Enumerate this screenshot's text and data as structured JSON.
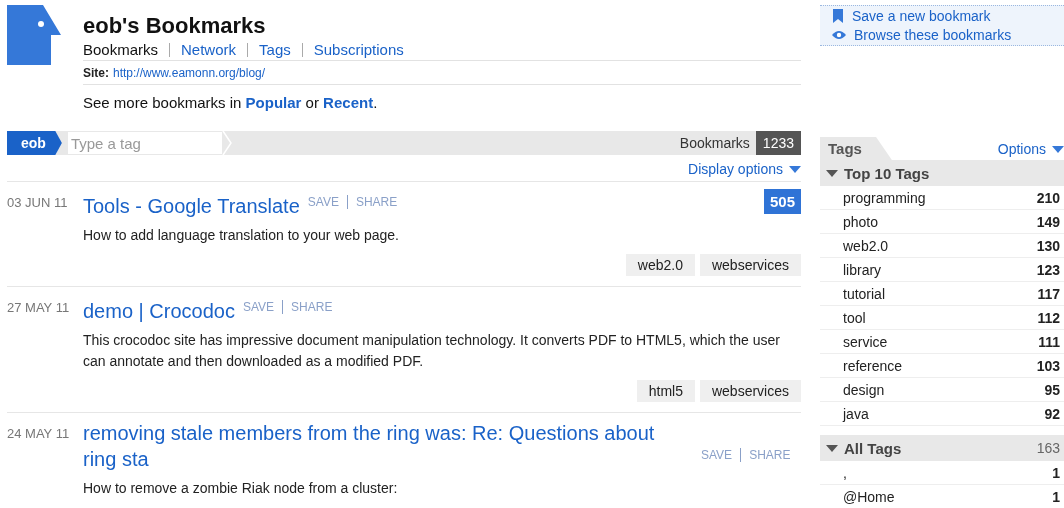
{
  "header": {
    "title": "eob's Bookmarks",
    "nav": [
      {
        "label": "Bookmarks",
        "selected": true
      },
      {
        "label": "Network",
        "selected": false
      },
      {
        "label": "Tags",
        "selected": false
      },
      {
        "label": "Subscriptions",
        "selected": false
      }
    ],
    "site_label": "Site:",
    "site_url": "http://www.eamonn.org/blog/",
    "more": {
      "prefix": "See more bookmarks in",
      "link_1": "Popular",
      "middle": "or",
      "link_2": "Recent",
      "suffix": "."
    }
  },
  "actions": [
    {
      "kind": "save",
      "label": "Save a new bookmark"
    },
    {
      "kind": "browse",
      "label": "Browse these bookmarks"
    }
  ],
  "tag_bar": {
    "user": "eob",
    "placeholder": "Type a tag",
    "count_label": "Bookmarks",
    "count": "1233"
  },
  "display_options": "Display options",
  "bookmarks": [
    {
      "date": "03 JUN 11",
      "title": "Tools - Google Translate",
      "save": "SAVE",
      "share": "SHARE",
      "count": "505",
      "description": "How to add language translation to your web page.",
      "tags": [
        "web2.0",
        "webservices"
      ]
    },
    {
      "date": "27 MAY 11",
      "title": "demo | Crocodoc",
      "save": "SAVE",
      "share": "SHARE",
      "description": "This crocodoc site has impressive document manipulation technology.  It converts PDF to HTML5, which the user can annotate and then downloaded as a modified PDF.",
      "tags": [
        "html5",
        "webservices"
      ]
    },
    {
      "date": "24 MAY 11",
      "title": "removing stale members from the ring was: Re: Questions about ring sta",
      "save": "SAVE",
      "share": "SHARE",
      "description": "How to remove a zombie Riak node from a cluster:"
    }
  ],
  "tags_panel": {
    "tab": "Tags",
    "options": "Options",
    "sections": [
      {
        "title": "Top 10 Tags",
        "expanded": true,
        "items": [
          {
            "name": "programming",
            "count": "210"
          },
          {
            "name": "photo",
            "count": "149"
          },
          {
            "name": "web2.0",
            "count": "130"
          },
          {
            "name": "library",
            "count": "123"
          },
          {
            "name": "tutorial",
            "count": "117"
          },
          {
            "name": "tool",
            "count": "112"
          },
          {
            "name": "service",
            "count": "111"
          },
          {
            "name": "reference",
            "count": "103"
          },
          {
            "name": "design",
            "count": "95"
          },
          {
            "name": "java",
            "count": "92"
          }
        ]
      },
      {
        "title": "All Tags",
        "count": "163",
        "expanded": true,
        "items": [
          {
            "name": ",",
            "count": "1"
          },
          {
            "name": "@Home",
            "count": "1"
          }
        ]
      }
    ]
  }
}
